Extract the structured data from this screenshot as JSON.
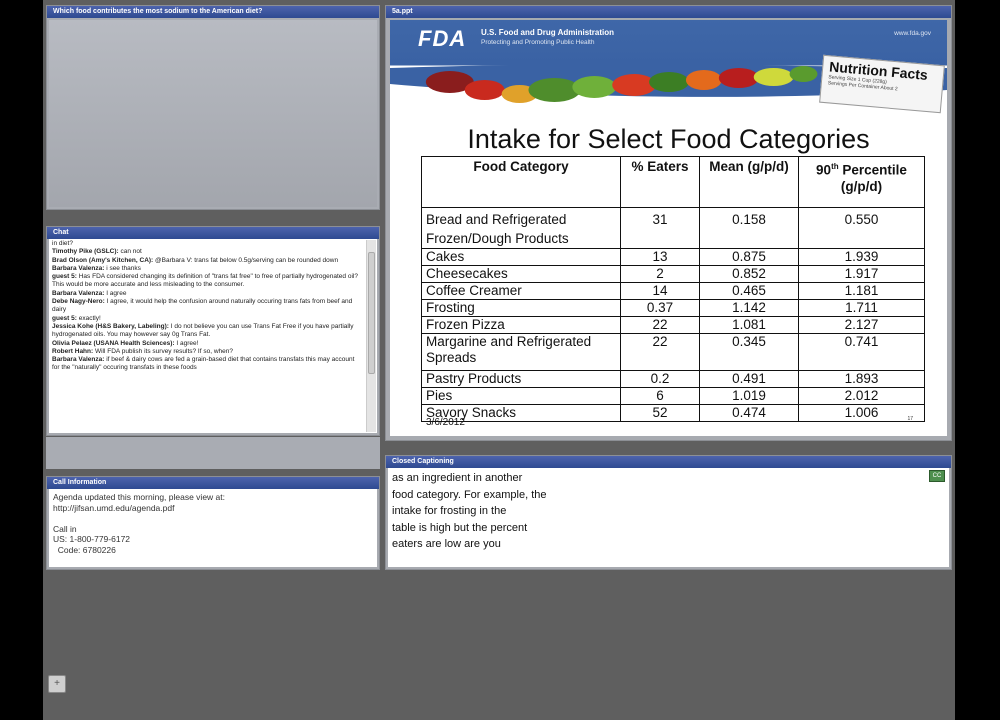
{
  "poll": {
    "title": "Which food contributes the most sodium to the American diet?"
  },
  "chat": {
    "title": "Chat",
    "messages": [
      {
        "author": "",
        "text": "in diet?"
      },
      {
        "author": "Timothy Pike (GSLC):",
        "text": " can not"
      },
      {
        "author": "Brad Olson (Amy's Kitchen, CA):",
        "text": " @Barbara V: trans fat below 0.5g/serving can be rounded down"
      },
      {
        "author": "Barbara Valenza:",
        "text": " i see  thanks"
      },
      {
        "author": "guest 5:",
        "text": " Has FDA considered changing its definition of \"trans fat free\" to free of partially hydrogenated oil?  This would be more accurate and less misleading to the consumer."
      },
      {
        "author": "Barbara Valenza:",
        "text": " I agree"
      },
      {
        "author": "Debe Nagy-Nero:",
        "text": " I agree, it would help the confusion around naturally occuring trans fats from beef and dairy"
      },
      {
        "author": "guest 5:",
        "text": " exactly!"
      },
      {
        "author": "Jessica Kohe (H&S Bakery, Labeling):",
        "text": " I do not believe you can use Trans Fat Free if you have partially hydrogenated oils.  You may however say 0g Trans Fat."
      },
      {
        "author": "Olivia Pelaez (USANA Health Sciences):",
        "text": " I agree!"
      },
      {
        "author": "Robert Hahn:",
        "text": " Will FDA publish its survey results?  If so, when?"
      },
      {
        "author": "Barbara Valenza:",
        "text": " if beef & dairy cows are fed a grain-based diet that contains transfats this may account for the \"naturally\" occuring transfats in these foods"
      }
    ]
  },
  "call_info": {
    "title": "Call Information",
    "lines": [
      "Agenda updated this morning, please view at:",
      "http://jifsan.umd.edu/agenda.pdf",
      "",
      "Call in",
      "US: 1-800-779-6172",
      "  Code: 6780226"
    ]
  },
  "slide_pod": {
    "title": "5a.ppt",
    "fda_logo": "FDA",
    "fda_name": "U.S. Food and Drug Administration",
    "fda_tagline": "Protecting and Promoting Public Health",
    "fda_url": "www.fda.gov",
    "nutrition_title": "Nutrition Facts",
    "nutrition_sub1": "Serving Size 1 Cup (228g)",
    "nutrition_sub2": "Servings Per Container About 2",
    "slide_title": "Intake for Select Food Categories",
    "headers": [
      "Food Category",
      "% Eaters",
      "Mean (g/p/d)",
      "90",
      "th",
      " Percentile (g/p/d)"
    ],
    "rows": [
      {
        "category": "Bread and Refrigerated Frozen/Dough Products",
        "eaters": "31",
        "mean": "0.158",
        "p90": "0.550"
      },
      {
        "category": "Cakes",
        "eaters": "13",
        "mean": "0.875",
        "p90": "1.939"
      },
      {
        "category": "Cheesecakes",
        "eaters": "2",
        "mean": "0.852",
        "p90": "1.917"
      },
      {
        "category": "Coffee Creamer",
        "eaters": "14",
        "mean": "0.465",
        "p90": "1.181"
      },
      {
        "category": "Frosting",
        "eaters": "0.37",
        "mean": "1.142",
        "p90": "1.711"
      },
      {
        "category": "Frozen Pizza",
        "eaters": "22",
        "mean": "1.081",
        "p90": "2.127"
      },
      {
        "category": "Margarine and Refrigerated Spreads",
        "eaters": "22",
        "mean": "0.345",
        "p90": "0.741"
      },
      {
        "category": "Pastry Products",
        "eaters": "0.2",
        "mean": "0.491",
        "p90": "1.893"
      },
      {
        "category": "Pies",
        "eaters": "6",
        "mean": "1.019",
        "p90": "2.012"
      },
      {
        "category": "Savory Snacks",
        "eaters": "52",
        "mean": "0.474",
        "p90": "1.006"
      }
    ],
    "date": "3/6/2012",
    "page_number": "17"
  },
  "captioning": {
    "title": "Closed Captioning",
    "lines": [
      "as an ingredient in another",
      "food category. For example, the",
      "intake for frosting in the",
      "table is high but the percent",
      "eaters are low are you"
    ],
    "button_label": "CC"
  },
  "bottom_tool": {
    "icon": "plus-icon",
    "glyph": "+"
  }
}
